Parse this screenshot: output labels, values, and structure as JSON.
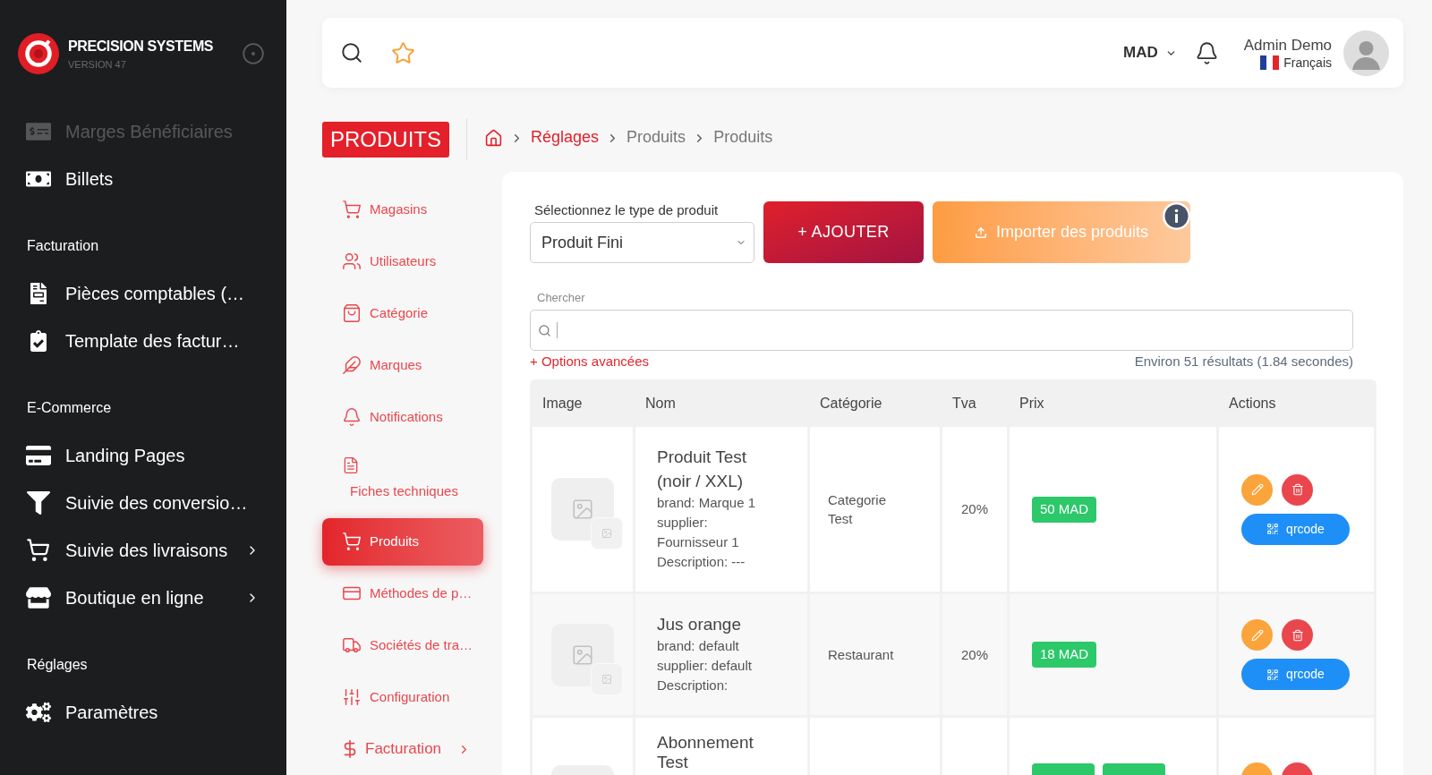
{
  "sidebar": {
    "brand": {
      "name": "PRECISION SYSTEMS",
      "version": "VERSION 47"
    },
    "sections": [
      {
        "items": [
          {
            "label": "Marges Bénéficiaires",
            "faded": true,
            "expandable": false
          },
          {
            "label": "Billets",
            "faded": false,
            "expandable": false
          }
        ]
      },
      {
        "heading": "Facturation",
        "items": [
          {
            "label": "Pièces comptables (…",
            "faded": false,
            "expandable": false
          },
          {
            "label": "Template des factur…",
            "faded": false,
            "expandable": false
          }
        ]
      },
      {
        "heading": "E-Commerce",
        "items": [
          {
            "label": "Landing Pages",
            "faded": false,
            "expandable": false
          },
          {
            "label": "Suivie des conversio…",
            "faded": false,
            "expandable": false
          },
          {
            "label": "Suivie des livraisons",
            "faded": false,
            "expandable": true
          },
          {
            "label": "Boutique en ligne",
            "faded": false,
            "expandable": true
          }
        ]
      },
      {
        "heading": "Réglages",
        "items": [
          {
            "label": "Paramètres",
            "faded": false,
            "expandable": false
          }
        ]
      }
    ]
  },
  "topbar": {
    "currency": "MAD",
    "user": {
      "name": "Admin Demo",
      "language": "Français"
    }
  },
  "page_title": "PRODUITS",
  "breadcrumb": [
    {
      "label": "Réglages",
      "link": true
    },
    {
      "label": "Produits",
      "link": false
    },
    {
      "label": "Produits",
      "link": false
    }
  ],
  "submenu": {
    "items": [
      {
        "label": "Magasins",
        "kind": "link",
        "selected": false
      },
      {
        "label": "Utilisateurs",
        "kind": "link",
        "selected": false
      },
      {
        "label": "Catégorie",
        "kind": "link",
        "selected": false
      },
      {
        "label": "Marques",
        "kind": "link",
        "selected": false
      },
      {
        "label": "Notifications",
        "kind": "link",
        "selected": false
      },
      {
        "label": "Fiches techniques",
        "kind": "stacked",
        "selected": false
      },
      {
        "label": "Produits",
        "kind": "link",
        "selected": true
      },
      {
        "label": "Méthodes de p…",
        "kind": "link",
        "selected": false
      },
      {
        "label": "Sociétés de tra…",
        "kind": "link",
        "selected": false
      },
      {
        "label": "Configuration",
        "kind": "link",
        "selected": false
      },
      {
        "label": "Facturation",
        "kind": "group",
        "selected": false
      }
    ]
  },
  "product_type": {
    "label": "Sélectionnez le type de produit",
    "value": "Produit Fini"
  },
  "buttons": {
    "add": "+ AJOUTER",
    "import": "Importer des produits"
  },
  "search": {
    "label": "Chercher",
    "advanced_link": "+ Options avancées",
    "results": "Environ 51 résultats (1.84 secondes)"
  },
  "table": {
    "columns": [
      "Image",
      "Nom",
      "Catégorie",
      "Tva",
      "Prix",
      "Actions"
    ],
    "rows": [
      {
        "kind": "full",
        "name": "Produit Test (noir / XXL)",
        "details": [
          "brand: Marque 1",
          "supplier: Fournisseur 1",
          "Description: ---"
        ],
        "category": "Categorie Test",
        "tva": "20%",
        "prices": [
          {
            "kind": "text",
            "label": "50 MAD"
          }
        ],
        "qrcode": "qrcode"
      },
      {
        "kind": "full",
        "name": "Jus orange",
        "details": [
          "brand: default",
          "supplier: default",
          "Description:"
        ],
        "category": "Restaurant",
        "tva": "20%",
        "prices": [
          {
            "kind": "text",
            "label": "18 MAD"
          }
        ],
        "qrcode": "qrcode"
      },
      {
        "kind": "cut",
        "name": "Abonnement Test",
        "prices": [
          {
            "kind": "cut"
          },
          {
            "kind": "cut"
          }
        ]
      }
    ]
  }
}
